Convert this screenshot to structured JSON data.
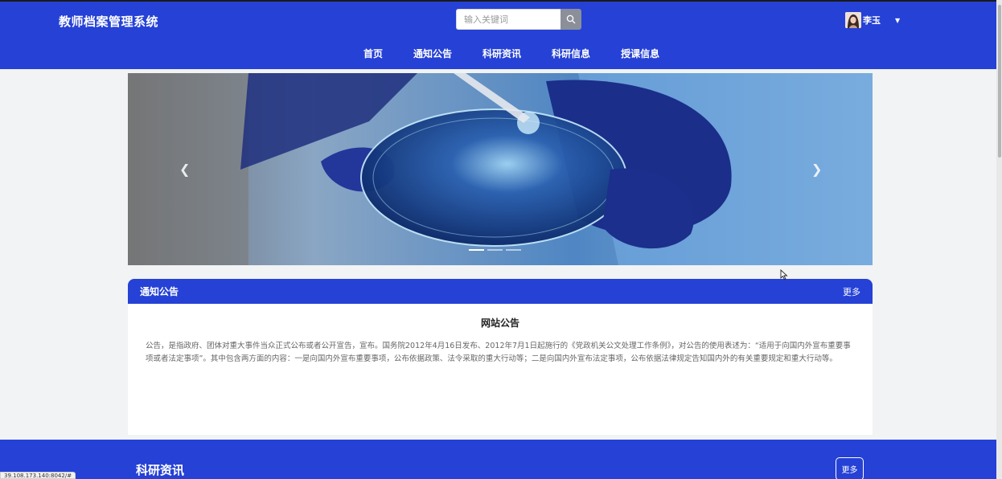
{
  "header": {
    "brand": "教师档案管理系统",
    "search": {
      "placeholder": "输入关键词",
      "value": ""
    },
    "user": {
      "name": "李玉"
    },
    "nav": [
      "首页",
      "通知公告",
      "科研资讯",
      "科研信息",
      "授课信息"
    ]
  },
  "banner": {
    "slide_count": 3,
    "active_slide": 0,
    "prev_icon": "chevron-left-icon",
    "next_icon": "chevron-right-icon"
  },
  "notice": {
    "section_title": "通知公告",
    "more_label": "更多",
    "item_title": "网站公告",
    "item_text": "公告，是指政府、团体对重大事件当众正式公布或者公开宣告，宣布。国务院2012年4月16日发布、2012年7月1日起施行的《党政机关公文处理工作条例》，对公告的使用表述为：“适用于向国内外宣布重要事项或者法定事项”。其中包含两方面的内容：一是向国内外宣布重要事项，公布依据政策、法令采取的重大行动等；二是向国内外宣布法定事项，公布依据法律规定告知国内外的有关重要规定和重大行动等。"
  },
  "research": {
    "section_title": "科研资讯",
    "more_label": "更多"
  },
  "statusbar": {
    "url": "39.108.173.140:8042/#"
  },
  "colors": {
    "primary": "#2541d6",
    "background": "#f1f3f4"
  }
}
